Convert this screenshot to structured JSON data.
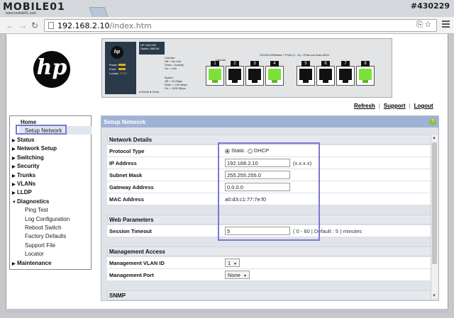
{
  "watermark": {
    "brand": "MOBILE01",
    "sub": "www.mobile01.com",
    "post_id": "#430229"
  },
  "browser": {
    "url_host": "192.168.2.10",
    "url_path": "/index.htm",
    "back_icon": "back-arrow-icon",
    "forward_icon": "forward-arrow-icon",
    "reload_icon": "reload-icon"
  },
  "switch_panel": {
    "hp_badge": "hp",
    "model": "HP 1810-8G Switch J9802A",
    "power": "Power",
    "fault": "Fault",
    "locator": "Locator",
    "linkact_title": "Link/Act:",
    "legend1": [
      "Off = No Link",
      "Flash = Activity",
      "On = Link"
    ],
    "speed_title": "Speed:",
    "legend2": [
      "Off = 10 Mbps",
      "Flash = 100 Mbps",
      "On = 1000 Mbps"
    ],
    "reset_clear": "● Reset  ● Clear",
    "ports_heading": "10/100/1000Base-T Ports (1 - 8) = Ports are Auto-MDIX",
    "link_act_spd": "Link/Act",
    "ports": [
      {
        "num": "1",
        "lit": true
      },
      {
        "num": "2",
        "lit": false
      },
      {
        "num": "3",
        "lit": false
      },
      {
        "num": "4",
        "lit": true
      },
      {
        "num": "5",
        "lit": false
      },
      {
        "num": "6",
        "lit": false
      },
      {
        "num": "7",
        "lit": false
      },
      {
        "num": "8",
        "lit": true
      }
    ]
  },
  "toplinks": {
    "refresh": "Refresh",
    "support": "Support",
    "logout": "Logout",
    "sep": "|"
  },
  "sidebar": {
    "home": "Home",
    "setup_network": "Setup Network",
    "items": [
      "Status",
      "Network Setup",
      "Switching",
      "Security",
      "Trunks",
      "VLANs",
      "LLDP",
      "Diagnostics"
    ],
    "diagnostics_sub": [
      "Ping Test",
      "Log Configuration",
      "Reboot Switch",
      "Factory Defaults",
      "Support File",
      "Locator"
    ],
    "maintenance": "Maintenance"
  },
  "main": {
    "title": "Setup Network",
    "help": "?",
    "network_details": {
      "header": "Network Details",
      "protocol_type_label": "Protocol Type",
      "static": "Static",
      "dhcp": "DHCP",
      "ip_label": "IP Address",
      "ip_value": "192.168.2.10",
      "ip_hint": "(x.x.x.x)",
      "subnet_label": "Subnet Mask",
      "subnet_value": "255.255.255.0",
      "gateway_label": "Gateway Address",
      "gateway_value": "0.0.0.0",
      "mac_label": "MAC Address",
      "mac_value": "a0:d3:c1:77:7e:f0"
    },
    "web_parameters": {
      "header": "Web Parameters",
      "timeout_label": "Session Timeout",
      "timeout_value": "5",
      "timeout_hint": "( 0 - 60 | Default : 5 ) minutes"
    },
    "management_access": {
      "header": "Management Access",
      "vlan_label": "Management VLAN ID",
      "vlan_value": "1",
      "port_label": "Management Port",
      "port_value": "None"
    },
    "snmp": {
      "header": "SNMP"
    }
  }
}
